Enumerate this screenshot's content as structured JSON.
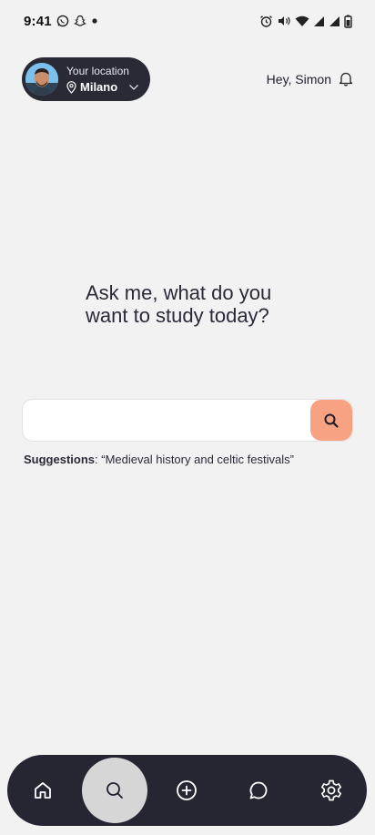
{
  "status_bar": {
    "time": "9:41",
    "left_icons": [
      "whatsapp-icon",
      "snapchat-icon",
      "notification-dot-icon"
    ],
    "right_icons": [
      "alarm-icon",
      "vibrate-icon",
      "wifi-icon",
      "signal-icon",
      "signal-icon",
      "battery-icon"
    ]
  },
  "header": {
    "location_label": "Your location",
    "location_city": "Milano",
    "greeting": "Hey, Simon"
  },
  "hero": {
    "question_line1": "Ask me, what do you",
    "question_line2": "want to study today?"
  },
  "search": {
    "value": "",
    "placeholder": ""
  },
  "suggestions": {
    "label": "Suggestions",
    "text": ": “Medieval history and celtic festivals”"
  },
  "bottom_nav": {
    "items": [
      "home-icon",
      "search-icon",
      "add-circle-icon",
      "chat-icon",
      "settings-icon"
    ],
    "active": "search-icon"
  },
  "colors": {
    "background": "#f2f2f2",
    "dark": "#262633",
    "accent": "#f7a282",
    "nav_active": "#d6d6d6"
  }
}
